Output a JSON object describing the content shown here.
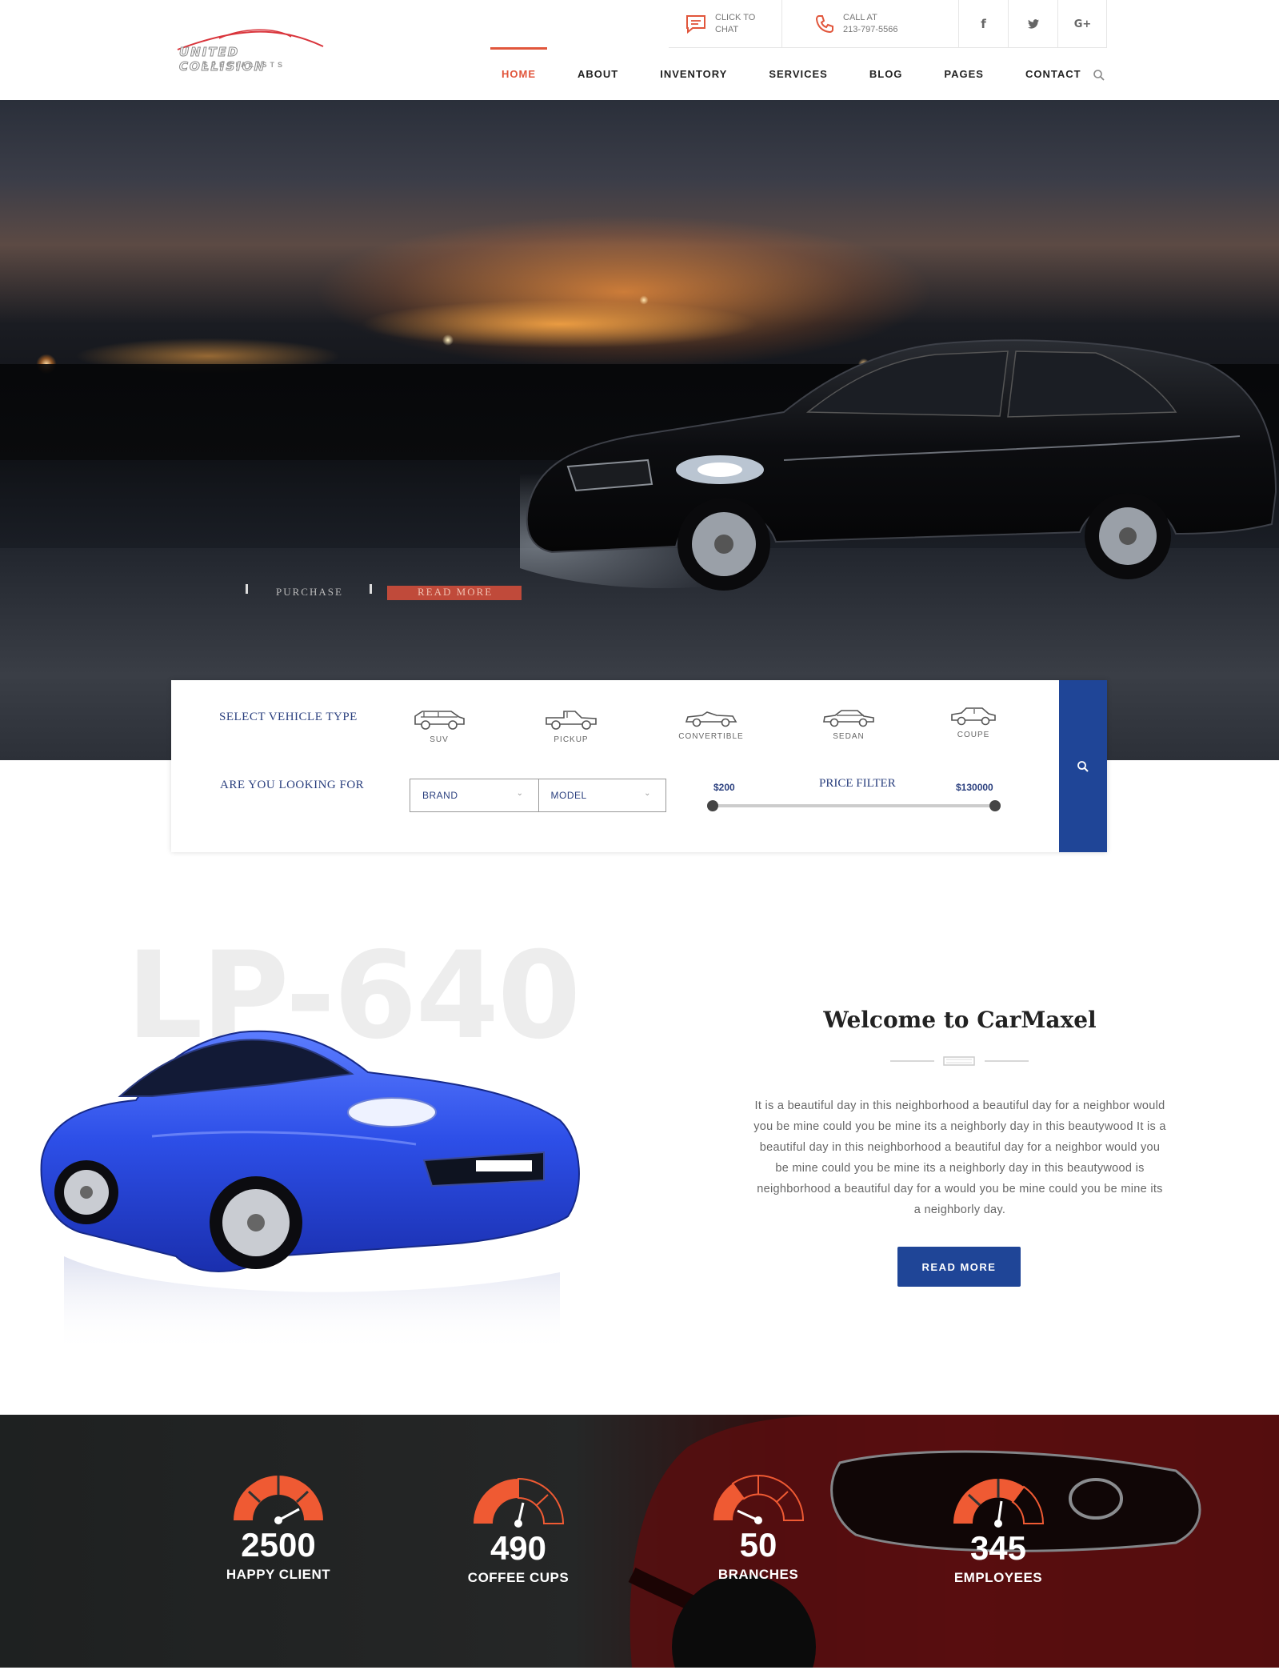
{
  "brand": {
    "logo_text": "UNITED COLLISION",
    "logo_sub": "SPECIALISTS"
  },
  "topbar": {
    "chat_line1": "Click to",
    "chat_line2": "Chat",
    "call_line1": "Call at",
    "call_line2": "213-797-5566",
    "social": [
      {
        "icon": "facebook-icon",
        "glyph": "f"
      },
      {
        "icon": "twitter-icon",
        "glyph": "t"
      },
      {
        "icon": "google-plus-icon",
        "glyph": "G+"
      }
    ]
  },
  "nav": {
    "items": [
      "HOME",
      "ABOUT",
      "INVENTORY",
      "SERVICES",
      "BLOG",
      "PAGES",
      "CONTACT"
    ],
    "active": "HOME"
  },
  "hero": {
    "btn_purchase": "PURCHASE",
    "btn_read_more": "READ MORE"
  },
  "search": {
    "vehicle_type_label": "SELECT VEHICLE TYPE",
    "looking_for_label": "ARE YOU LOOKING FOR",
    "vehicle_types": [
      "SUV",
      "PICKUP",
      "CONVERTIBLE",
      "SEDAN",
      "COUPE"
    ],
    "brand_select": "BRAND",
    "model_select": "MODEL",
    "price_title": "PRICE FILTER",
    "price_min": "$200",
    "price_max": "$130000"
  },
  "welcome": {
    "watermark": "LP-640",
    "title": "Welcome to CarMaxel",
    "body": "It is a beautiful day in this neighborhood a beautiful day for a neighbor would you be mine could you be mine its a neighborly day in this beautywood It is a beautiful day in this neighborhood a beautiful day for a neighbor would you be mine could you be mine its a neighborly day in this beautywood is neighborhood a beautiful day for a would you be mine could you be mine its a neighborly day.",
    "button": "READ MORE"
  },
  "counters": [
    {
      "value": "2500",
      "label": "HAPPY CLIENT"
    },
    {
      "value": "490",
      "label": "COFFEE CUPS"
    },
    {
      "value": "50",
      "label": "BRANCHES"
    },
    {
      "value": "345",
      "label": "EMPLOYEES"
    }
  ],
  "colors": {
    "accent": "#e1563c",
    "primary_blue": "#1f4597",
    "label_blue": "#2a3f7e"
  }
}
